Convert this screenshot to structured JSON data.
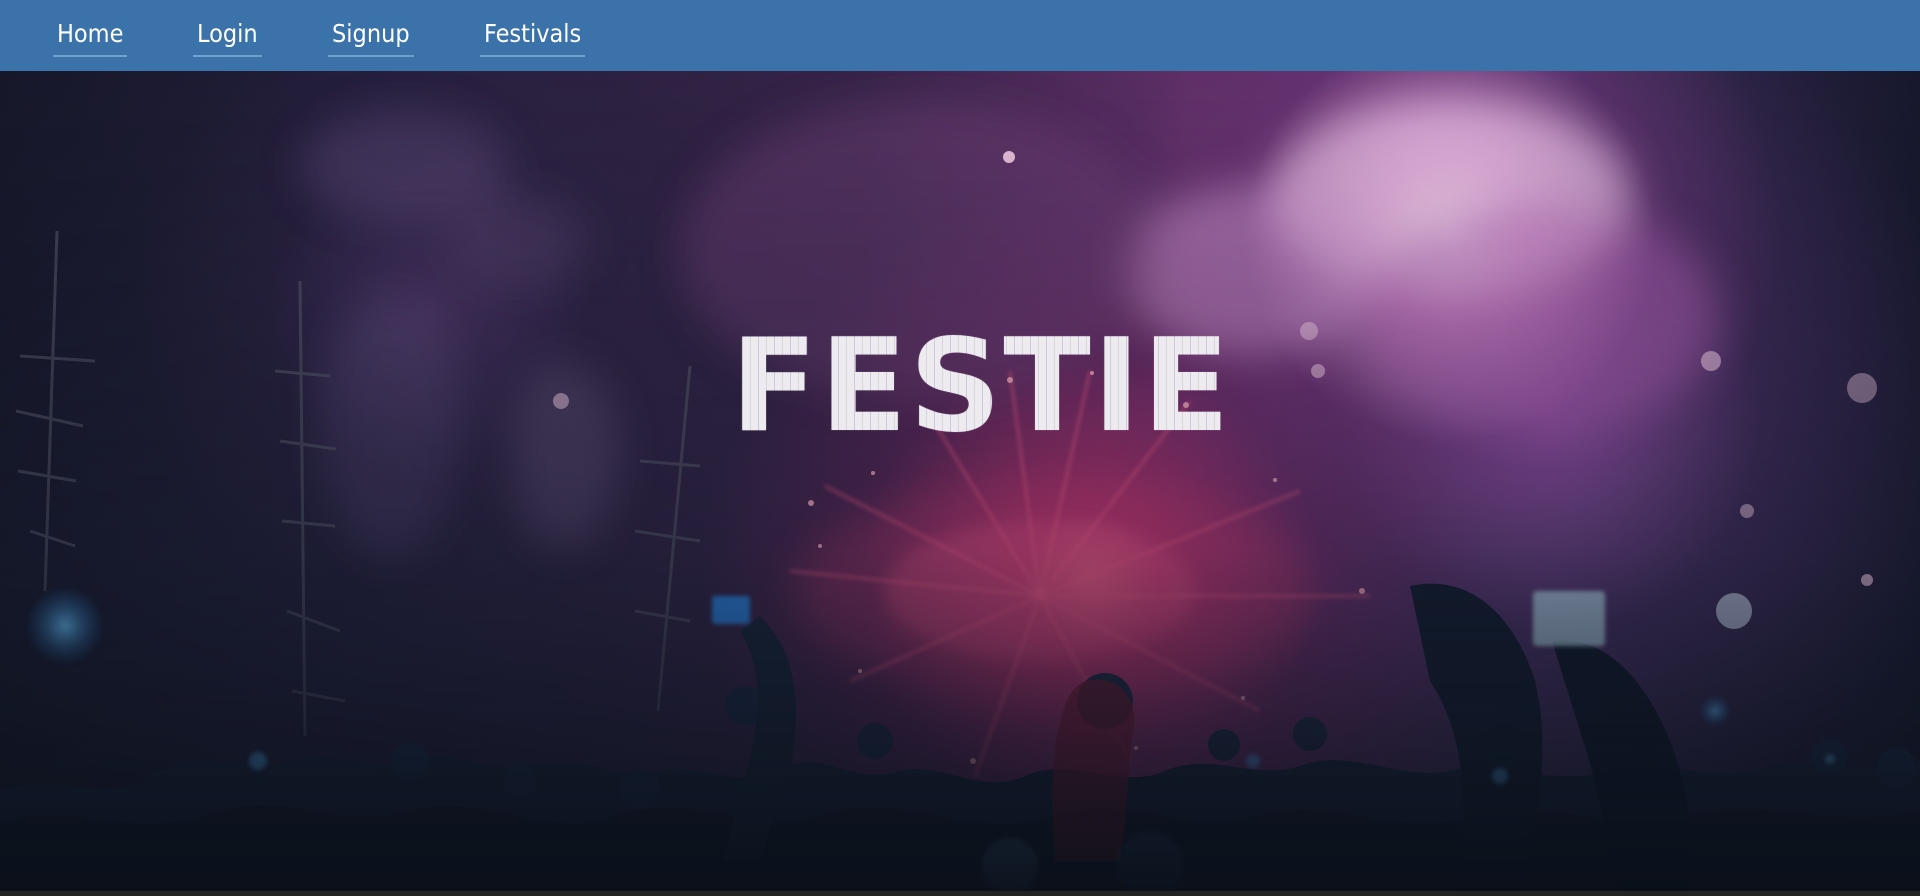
{
  "navigation": {
    "items": [
      {
        "label": "Home"
      },
      {
        "label": "Login"
      },
      {
        "label": "Signup"
      },
      {
        "label": "Festivals"
      }
    ]
  },
  "hero": {
    "title": "FESTIE"
  },
  "colors": {
    "navbar": "#3a72a9",
    "nav_text": "#ffffff",
    "hero_title": "#dad7df",
    "accent_pink": "#e93a77",
    "accent_purple": "#8e3f96"
  }
}
